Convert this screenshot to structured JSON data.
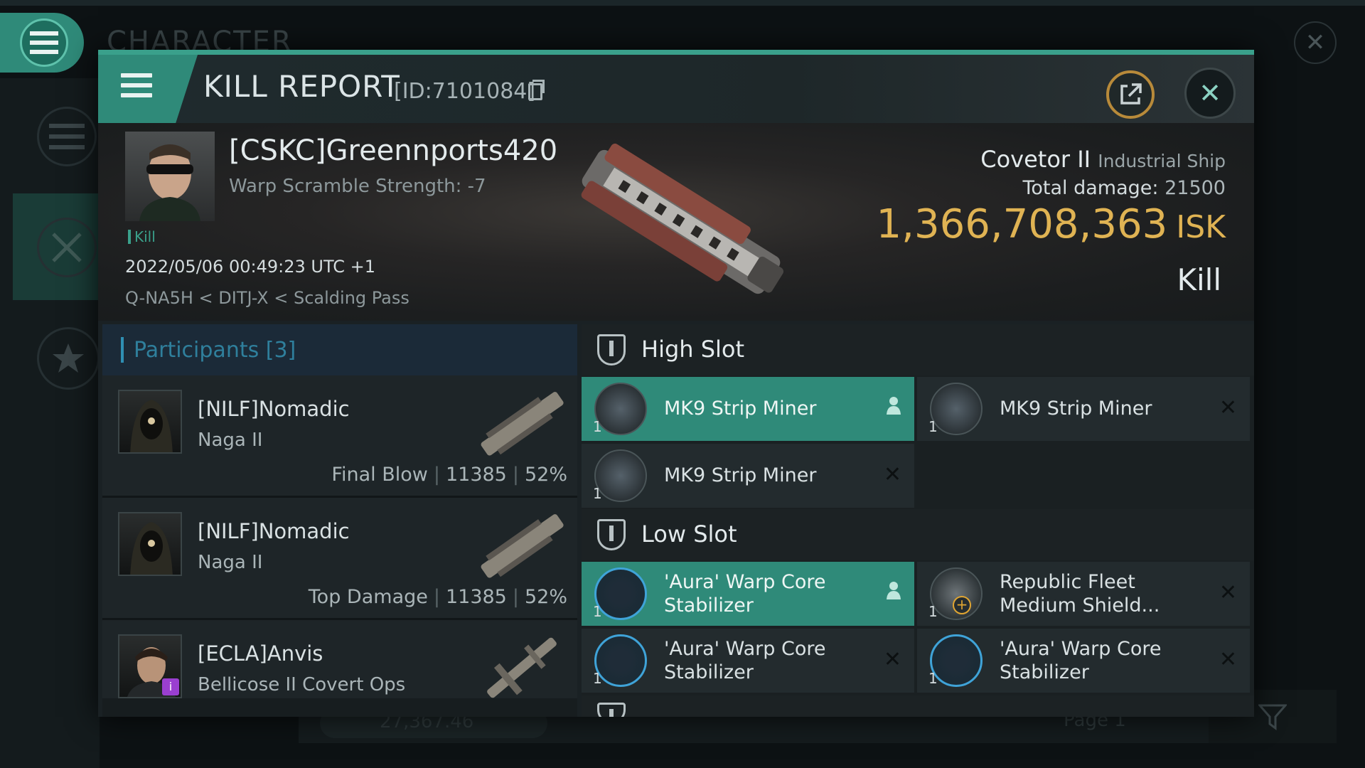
{
  "background": {
    "title": "CHARACTER",
    "footer_value": "27,367.46",
    "footer_page": "Page 1"
  },
  "header": {
    "title": "KILL REPORT",
    "id_label": "[ID:7101084]"
  },
  "victim": {
    "name": "[CSKC]Greennports420",
    "warp_scramble": "Warp Scramble Strength: -7",
    "tag": "Kill",
    "datetime": "2022/05/06 00:49:23 UTC +1",
    "location": "Q-NA5H < DITJ-X < Scalding Pass",
    "ship_name": "Covetor II",
    "ship_class": "Industrial Ship",
    "damage_label": "Total damage:",
    "damage_value": "21500",
    "isk_value": "1,366,708,363",
    "isk_unit": "ISK",
    "result": "Kill"
  },
  "participants": {
    "header": "Participants [3]",
    "rows": [
      {
        "name": "[NILF]Nomadic",
        "ship": "Naga II",
        "role": "Final Blow",
        "damage": "11385",
        "percent": "52%"
      },
      {
        "name": "[NILF]Nomadic",
        "ship": "Naga II",
        "role": "Top Damage",
        "damage": "11385",
        "percent": "52%"
      },
      {
        "name": "[ECLA]Anvis",
        "ship": "Bellicose II Covert Ops"
      }
    ]
  },
  "fitting": {
    "high_slot": {
      "title": "High Slot",
      "items": [
        {
          "name": "MK9 Strip Miner",
          "qty": "1"
        },
        {
          "name": "MK9 Strip Miner",
          "qty": "1"
        },
        {
          "name": "MK9 Strip Miner",
          "qty": "1"
        }
      ]
    },
    "low_slot": {
      "title": "Low Slot",
      "items": [
        {
          "name_l1": "'Aura' Warp Core",
          "name_l2": "Stabilizer",
          "qty": "1"
        },
        {
          "name_l1": "Republic Fleet",
          "name_l2": "Medium Shield...",
          "qty": "1"
        },
        {
          "name_l1": "'Aura' Warp Core",
          "name_l2": "Stabilizer",
          "qty": "1"
        },
        {
          "name_l1": "'Aura' Warp Core",
          "name_l2": "Stabilizer",
          "qty": "1"
        }
      ]
    }
  },
  "colors": {
    "accent": "#3aa08b",
    "isk": "#e0b353",
    "participants_header": "#2f7f9c"
  }
}
